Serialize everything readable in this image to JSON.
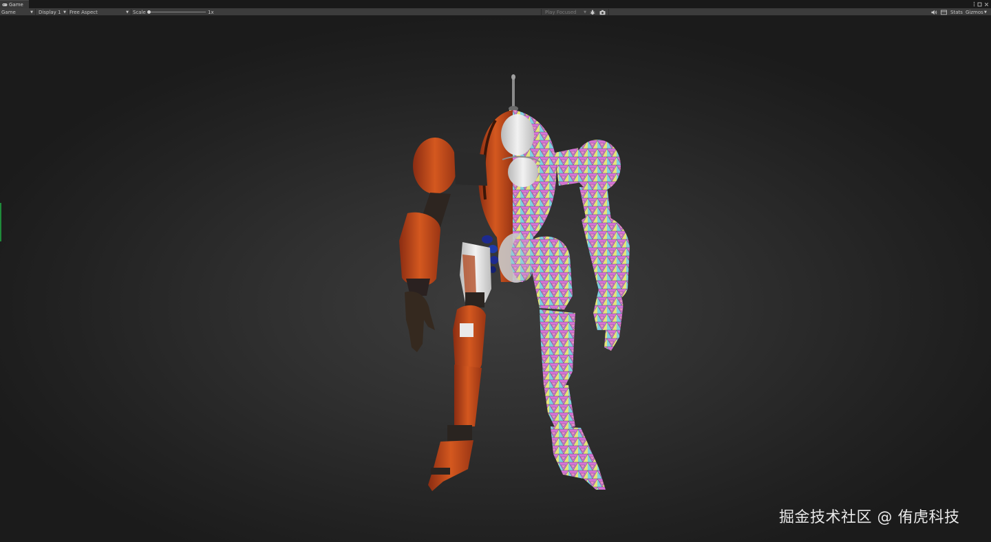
{
  "window": {
    "tab_label": "Game",
    "tab_icon": "gamepad-icon"
  },
  "toolbar": {
    "mode_label": "Game",
    "display_label": "Display 1",
    "aspect_label": "Free Aspect",
    "scale_label": "Scale",
    "scale_value": "1x",
    "scale_fraction": 0.0,
    "play_mode_label": "Play Focused",
    "stats_label": "Stats",
    "gizmos_label": "Gizmos",
    "icons": [
      "bug-icon",
      "camera-icon",
      "speaker-icon",
      "layout-icon"
    ]
  },
  "watermark": {
    "text": "掘金技术社区 @ 侑虎科技"
  },
  "colors": {
    "toolbar_bg": "#3c3c3c",
    "tab_bg": "#383838",
    "viewport_bg": "#2e2e2e",
    "robot_orange": "#c4461e",
    "robot_white": "#e4e4e4",
    "wireframe_magenta": "#d86ad8",
    "wireframe_cyan": "#6ad0d8",
    "wireframe_yellow": "#e0e070"
  }
}
